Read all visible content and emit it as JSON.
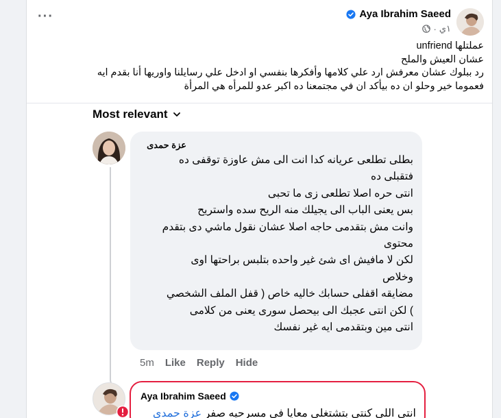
{
  "post": {
    "author": "Aya Ibrahim Saeed",
    "time": "١ي",
    "body_lines": [
      "عملتلها unfriend",
      "عشان العيش والملح",
      "رد ببلوك عشان معرفش ارد علي كلامها وأفكرها بنفسي او ادخل علي رسايلنا واوريها أنا بقدم ايه",
      "فعموما خير وحلو ان ده بيأكد ان في مجتمعنا ده اكبر عدو للمرأه هي المرأة"
    ]
  },
  "comments_sort": {
    "label": "Most relevant"
  },
  "comment": {
    "author": "عزة حمدى",
    "lines": [
      "بطلى تطلعى عريانه كدا انت الى مش عاوزة توقفى ده",
      "فتقبلى ده",
      "انتى حره اصلا تطلعى زى ما تحبى",
      "بس يعنى الباب الى يجيلك منه الريح سده واستريح",
      "وانت مش بتقدمى حاجه اصلا عشان نقول ماشي دى بتقدم",
      "محتوى",
      "لكن لا مافيش اى شئ غير واحده بتلبس براحتها اوى",
      "وخلاص",
      "مضايقه اقفلى حسابك خاليه خاص ( قفل الملف الشخصي",
      ") لكن انتى عجبك الى بيحصل سورى يعنى من كلامى",
      "انتى مين وبتقدمى ايه غير نفسك"
    ],
    "time": "5m",
    "like_label": "Like",
    "reply_label": "Reply",
    "hide_label": "Hide"
  },
  "reply": {
    "author": "Aya Ibrahim Saeed",
    "mention": "عزة حمدى",
    "text": "انتى اللي كنتي بتشتغلي معايا في مسرحيه صفر"
  },
  "colors": {
    "verified": "#1877f2",
    "alert": "#e41e3f",
    "mention": "#216fdb",
    "secondary_text": "#65676b"
  }
}
